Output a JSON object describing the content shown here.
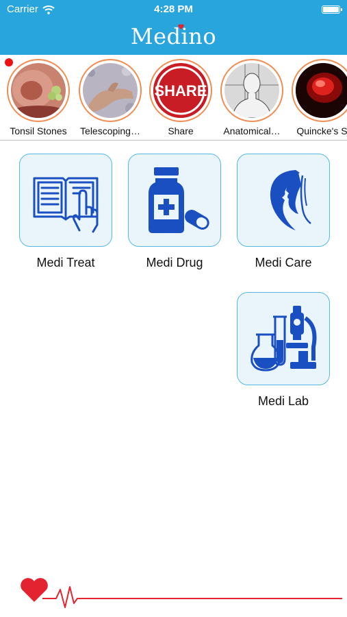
{
  "status": {
    "carrier": "Carrier",
    "time": "4:28 PM"
  },
  "header": {
    "title": "Medino"
  },
  "stories": [
    {
      "label": "Tonsil Stones",
      "image": "throat-photo"
    },
    {
      "label": "Telescoping…",
      "image": "hand-photo"
    },
    {
      "label": "Share",
      "image": "share-sign",
      "sign_text": "SHARE"
    },
    {
      "label": "Anatomical…",
      "image": "anatomy-figure"
    },
    {
      "label": "Quincke's Si",
      "image": "red-glow-photo"
    }
  ],
  "tiles": [
    {
      "label": "Medi Treat",
      "icon": "book-hand-icon"
    },
    {
      "label": "Medi Drug",
      "icon": "medicine-bottle-icon"
    },
    {
      "label": "Medi Care",
      "icon": "face-silhouette-icon"
    },
    {
      "label": "Medi Lab",
      "icon": "microscope-icon"
    }
  ],
  "colors": {
    "header": "#29a5de",
    "icon_blue": "#1a4fc2",
    "story_ring": "#f28b50",
    "heart": "#e3232f"
  }
}
